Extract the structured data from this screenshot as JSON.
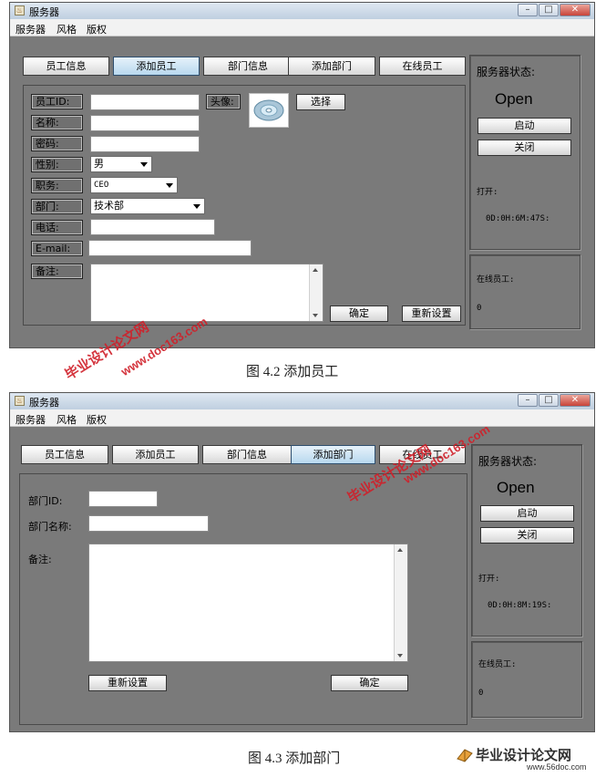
{
  "window_title": "服务器",
  "menu": [
    "服务器",
    "风格",
    "版权"
  ],
  "tabs": [
    "员工信息",
    "添加员工",
    "部门信息",
    "添加部门",
    "在线员工"
  ],
  "status": {
    "title": "服务器状态:",
    "state": "Open",
    "start_button": "启动",
    "stop_button": "关闭",
    "uptime_label": "打开:",
    "online_label": "在线员工:",
    "online_count": "0"
  },
  "screen1": {
    "selected_tab": "添加员工",
    "uptime": "0D:0H:6M:47S:",
    "labels": {
      "employee_id": "员工ID:",
      "name": "名称:",
      "password": "密码:",
      "gender": "性别:",
      "position": "职务:",
      "department": "部门:",
      "phone": "电话:",
      "email": "E-mail:",
      "remark": "备注:",
      "avatar": "头像:"
    },
    "gender_value": "男",
    "position_value": "CEO",
    "department_value": "技术部",
    "choose_button": "选择",
    "confirm_button": "确定",
    "reset_button": "重新设置",
    "caption": "图 4.2  添加员工"
  },
  "screen2": {
    "selected_tab": "添加部门",
    "uptime": "0D:0H:8M:19S:",
    "labels": {
      "dept_id": "部门ID:",
      "dept_name": "部门名称:",
      "remark": "备注:"
    },
    "reset_button": "重新设置",
    "confirm_button": "确定",
    "caption": "图 4.3  添加部门"
  },
  "watermarks": {
    "site_name": "毕业设计论文网",
    "site_url_1": "www.doc163.com",
    "site_url_2": "www.56doc.com"
  }
}
